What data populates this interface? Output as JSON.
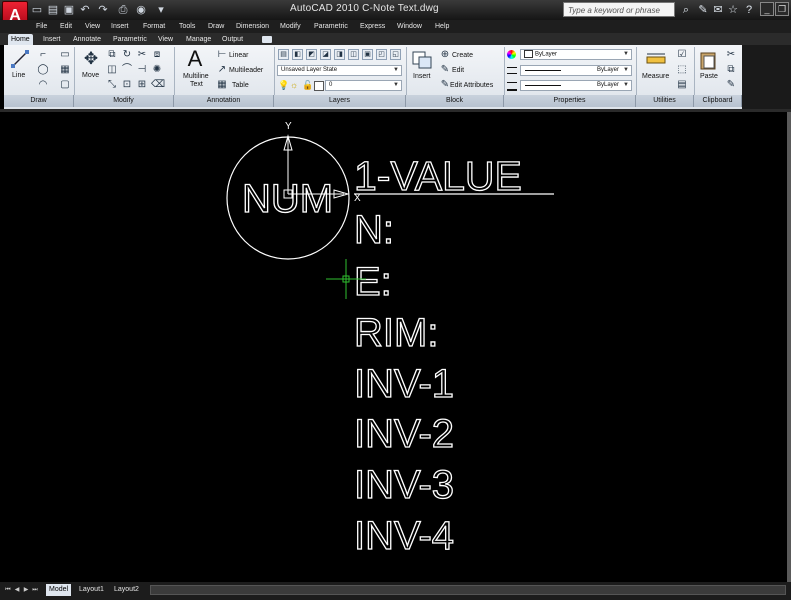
{
  "app": {
    "title": "AutoCAD 2010    C-Note Text.dwg",
    "logo_letter": "A",
    "search_placeholder": "Type a keyword or phrase"
  },
  "quick_access": [
    "open-icon",
    "save-icon",
    "undo-icon",
    "redo-icon",
    "print-icon",
    "workspace-icon"
  ],
  "menu": [
    "File",
    "Edit",
    "View",
    "Insert",
    "Format",
    "Tools",
    "Draw",
    "Dimension",
    "Modify",
    "Parametric",
    "Express",
    "Window",
    "Help"
  ],
  "ribbon_tabs": [
    "Home",
    "Insert",
    "Annotate",
    "Parametric",
    "View",
    "Manage",
    "Output"
  ],
  "ribbon": {
    "draw": {
      "title": "Draw",
      "line": "Line"
    },
    "modify": {
      "title": "Modify",
      "move": "Move"
    },
    "annotation": {
      "title": "Annotation",
      "mtext_line1": "Multiline",
      "mtext_line2": "Text",
      "linear": "Linear",
      "multileader": "Multileader",
      "table": "Table"
    },
    "layers": {
      "title": "Layers",
      "state": "Unsaved Layer State",
      "current": "0"
    },
    "block": {
      "title": "Block",
      "insert": "Insert",
      "create": "Create",
      "edit": "Edit",
      "edit_attributes": "Edit Attributes"
    },
    "properties": {
      "title": "Properties",
      "color": "ByLayer",
      "linetype": "ByLayer",
      "lineweight": "ByLayer"
    },
    "utilities": {
      "title": "Utilities",
      "measure": "Measure"
    },
    "clipboard": {
      "title": "Clipboard",
      "paste": "Paste"
    }
  },
  "drawing": {
    "circle_label": "NUM",
    "axis_y": "Y",
    "axis_x": "X",
    "lines": [
      "1-VALUE",
      "N:",
      "E:",
      "RIM:",
      "INV-1",
      "INV-2",
      "INV-3",
      "INV-4"
    ]
  },
  "layout_tabs": [
    "Model",
    "Layout1",
    "Layout2"
  ],
  "colors": {
    "drawing_background": "#000000",
    "drawing_text": "#ffffff",
    "crosshair": "#2fbf2f",
    "ribbon_background": "#e4e9ef"
  }
}
